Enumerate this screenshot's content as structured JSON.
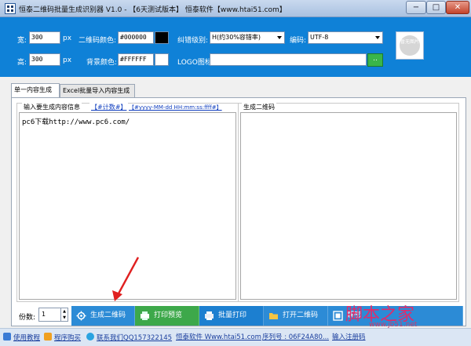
{
  "window": {
    "title": "恒泰二维码批量生成识别器 V1.0 - 【6天测试版本】 恒泰软件【www.htai51.com】",
    "min_label": "−",
    "max_label": "□",
    "close_label": "✕"
  },
  "settings": {
    "width_label": "宽:",
    "width_value": "300",
    "width_unit": "px",
    "height_label": "高:",
    "height_value": "300",
    "height_unit": "px",
    "qr_color_label": "二维码颜色:",
    "qr_color_value": "#000000",
    "qr_color": "#000000",
    "bg_color_label": "背景颜色:",
    "bg_color_value": "#FFFFFF",
    "bg_color": "#FFFFFF",
    "error_level_label": "纠错级别:",
    "error_level_value": "H(约30%容错率)",
    "encoding_label": "编码:",
    "encoding_value": "UTF-8",
    "logo_label": "LOGO图标:",
    "logo_value": "",
    "logo_browse_label": "..",
    "preview_placeholder": "暂无图片"
  },
  "tabs": [
    {
      "label": "单一内容生成",
      "active": true
    },
    {
      "label": "Excel批量导入内容生成",
      "active": false
    }
  ],
  "left_group": {
    "title": "输入要生成内容信息",
    "counter_tag": "【#计数#】",
    "date_tag": "【#yyyy-MM-dd HH:mm:ss:ffff#】",
    "content": "pc6下载http://www.pc6.com/"
  },
  "right_group": {
    "title": "生成二维码"
  },
  "bottom": {
    "count_label": "份数:",
    "count_value": "1",
    "buttons": [
      {
        "label": "生成二维码",
        "color": "#2c8bd6",
        "icon": "gear-icon"
      },
      {
        "label": "打印预览",
        "color": "#3da84a",
        "icon": "print-preview-icon"
      },
      {
        "label": "批量打印",
        "color": "#1c7fd0",
        "icon": "printer-icon"
      },
      {
        "label": "打开二维码",
        "color": "#2c8bd6",
        "icon": "folder-icon"
      },
      {
        "label": "解密",
        "color": "#2c8bd6",
        "icon": "decode-icon"
      }
    ]
  },
  "status": {
    "tutorial": "使用教程",
    "buy": "程序购买",
    "contact": "联系我们QQ157322145",
    "site": "恒泰软件 Www.htai51.com",
    "serial": "序列号 : 06F24A80...",
    "register": "输入注册码"
  },
  "watermark": {
    "text": "脚本之家",
    "url": "www.jb51.net"
  }
}
